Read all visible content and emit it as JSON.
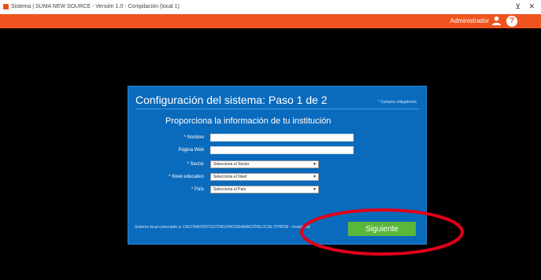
{
  "window": {
    "title": "Sistema | SUMA NEW SOURCE - Versión 1.0 - Compilación (local 1)",
    "minimize": "⊻",
    "close": "✕"
  },
  "header": {
    "user": "Administrador",
    "help": "?"
  },
  "dialog": {
    "title": "Configuración del sistema: Paso 1 de 2",
    "required_note": "* Campos obligatorios",
    "subtitle": "Proporciona la información de tu institución",
    "fields": {
      "nombre_label": "* Nombre",
      "pagina_label": "Página Web",
      "sector_label": "* Sector",
      "sector_value": "Selecciona el Sector",
      "nivel_label": "* Nivel educativo",
      "nivel_value": "Selecciona el Nivel",
      "pais_label": "* País",
      "pais_value": "Selecciona el País"
    },
    "footer_note": "Sistema local conectado a: CASTRAVOR\\TESTING\\PROGRAMACIÓN\\LOCAL\\TPROM - modalidad",
    "next_button": "Siguiente"
  },
  "colors": {
    "header": "#f0541e",
    "dialog": "#0a6bbd",
    "next_button": "#5bb73b",
    "highlight": "#e0001b"
  }
}
